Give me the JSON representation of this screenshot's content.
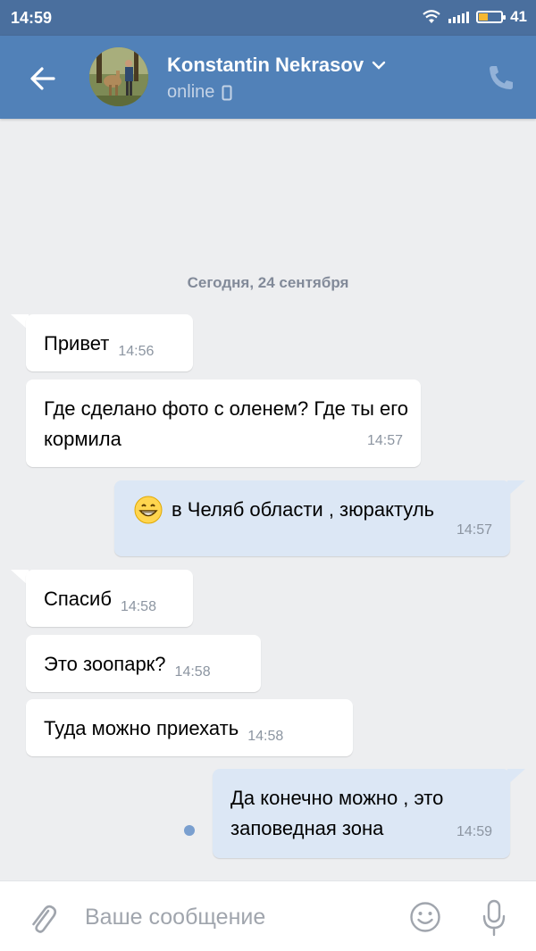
{
  "statusbar": {
    "time": "14:59",
    "battery": "41",
    "battery_level": 0.41
  },
  "header": {
    "contact_name": "Konstantin Nekrasov",
    "status": "online"
  },
  "chat": {
    "date_separator": "Сегодня, 24 сентября",
    "messages": [
      {
        "dir": "in",
        "text": "Привет",
        "time": "14:56"
      },
      {
        "dir": "in",
        "text": "Где сделано фото с оленем? Где ты его кормила",
        "time": "14:57"
      },
      {
        "dir": "out",
        "text": "в Челяб области , зюрактуль",
        "time": "14:57",
        "emoji": "grinning-face"
      },
      {
        "dir": "in",
        "text": "Спасиб",
        "time": "14:58"
      },
      {
        "dir": "in",
        "text": "Это зоопарк?",
        "time": "14:58"
      },
      {
        "dir": "in",
        "text": "Туда можно приехать",
        "time": "14:58"
      },
      {
        "dir": "out",
        "text": "Да конечно можно , это заповедная зона",
        "time": "14:59"
      }
    ]
  },
  "composer": {
    "placeholder": "Ваше сообщение",
    "value": ""
  },
  "colors": {
    "header": "#5181b8",
    "statusbar": "#4a6f9e",
    "background": "#edeef0",
    "outgoing_bubble": "#dce7f5",
    "incoming_bubble": "#ffffff"
  }
}
